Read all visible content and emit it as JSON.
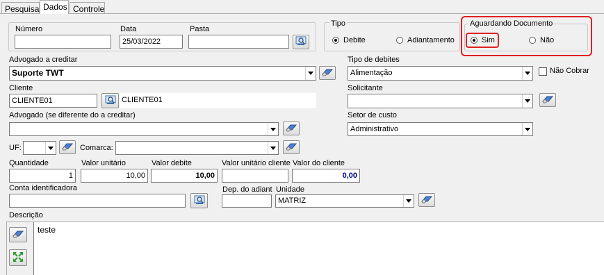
{
  "tabs": [
    {
      "label": "Pesquisa"
    },
    {
      "label": "Dados"
    },
    {
      "label": "Controle"
    }
  ],
  "fields": {
    "numero": {
      "label": "Número",
      "value": ""
    },
    "data": {
      "label": "Data",
      "value": "25/03/2022"
    },
    "pasta": {
      "label": "Pasta",
      "value": ""
    },
    "advogado_creditar": {
      "label": "Advogado a creditar",
      "value": "Suporte TWT"
    },
    "cliente": {
      "label": "Cliente",
      "code": "CLIENTE01",
      "name": "CLIENTE01"
    },
    "advogado_diferente": {
      "label": "Advogado  (se diferente do a creditar)",
      "value": ""
    },
    "uf": {
      "label": "UF:",
      "value": ""
    },
    "comarca": {
      "label": "Comarca:",
      "value": ""
    },
    "quantidade": {
      "label": "Quantidade",
      "value": "1"
    },
    "valor_unitario": {
      "label": "Valor unitário",
      "value": "10,00"
    },
    "valor_debite": {
      "label": "Valor debite",
      "value": "10,00"
    },
    "valor_unitario_cliente": {
      "label": "Valor unitário cliente",
      "value": ""
    },
    "valor_cliente": {
      "label": "Valor do cliente",
      "value": "0,00"
    },
    "conta": {
      "label": "Conta identificadora",
      "value": ""
    },
    "dep_adiant": {
      "label": "Dep. do adiant",
      "value": ""
    },
    "unidade": {
      "label": "Unidade",
      "value": "MATRIZ"
    },
    "descricao": {
      "label": "Descrição",
      "value": "teste"
    },
    "tipo_debites": {
      "label": "Tipo de debites",
      "value": "Alimentação"
    },
    "nao_cobrar": {
      "label": "Não Cobrar",
      "checked": false
    },
    "solicitante": {
      "label": "Solicitante",
      "value": ""
    },
    "setor_custo": {
      "label": "Setor de custo",
      "value": "Administrativo"
    }
  },
  "tipo": {
    "label": "Tipo",
    "options": [
      {
        "label": "Debite",
        "selected": true
      },
      {
        "label": "Adiantamento",
        "selected": false
      }
    ]
  },
  "aguardando": {
    "label": "Aguardando Documento",
    "options": [
      {
        "label": "Sim",
        "selected": true
      },
      {
        "label": "Não",
        "selected": false
      }
    ],
    "highlight_color": "#e02020"
  },
  "colors": {
    "window_bg": "#f0f0f0",
    "valor_cliente_text": "#000080"
  }
}
